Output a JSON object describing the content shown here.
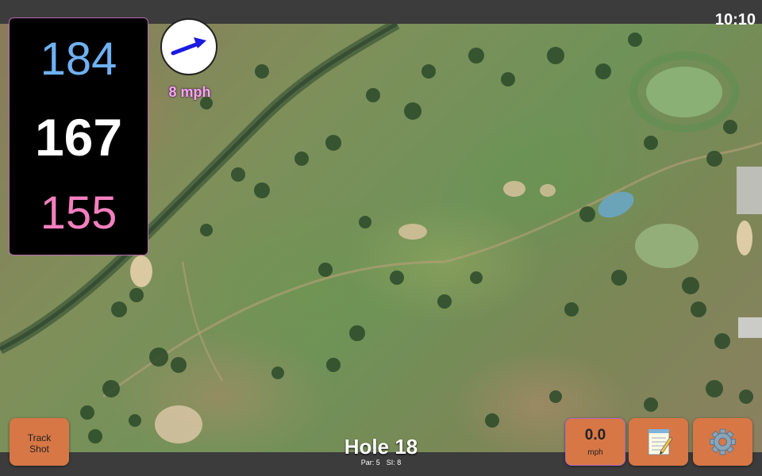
{
  "status_bar": {
    "time": "10:10"
  },
  "yardage": {
    "back": "184",
    "middle": "167",
    "front": "155"
  },
  "wind": {
    "speed_text": "8 mph",
    "arrow_icon": "wind-direction-arrow-icon"
  },
  "hole": {
    "title": "Hole 18",
    "par_label": "Par: 5",
    "si_label": "SI: 8"
  },
  "buttons": {
    "track_shot_line1": "Track",
    "track_shot_line2": "Shot",
    "speed_value": "0.0",
    "speed_unit": "mph",
    "notes_icon": "notepad-icon",
    "settings_icon": "gear-icon"
  },
  "colors": {
    "back_yardage": "#6fb1f2",
    "middle_yardage": "#ffffff",
    "front_yardage": "#f47fbf",
    "button_bg": "#d77746",
    "wind_text": "#f3a6ee",
    "accent_border": "#b86ab0"
  }
}
